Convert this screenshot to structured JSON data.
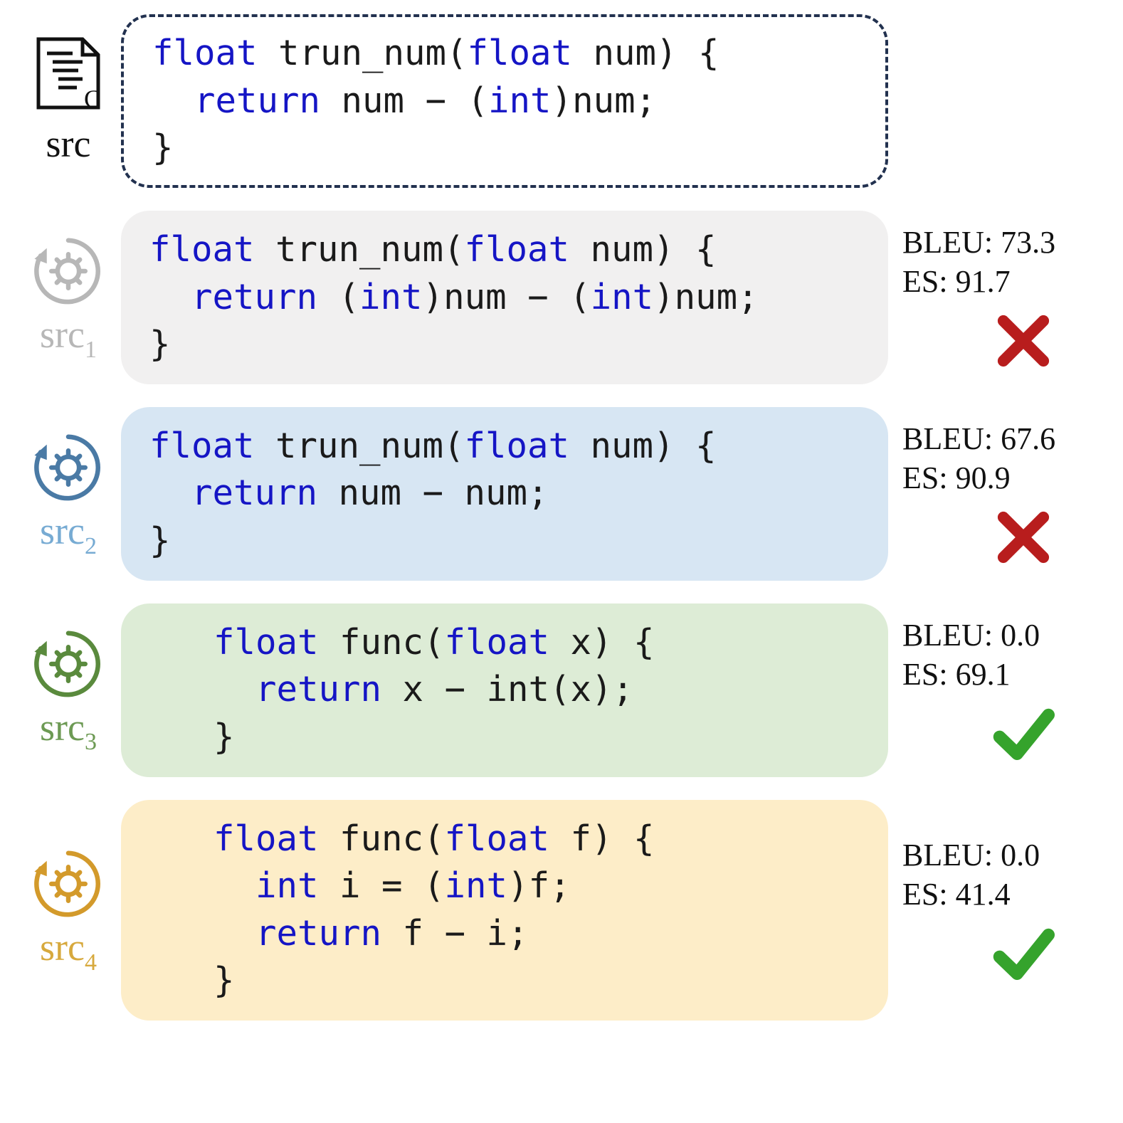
{
  "src": {
    "label": "src",
    "code": {
      "sig_prefix": "float",
      "sig_name": " trun_num(",
      "sig_arg_type": "float",
      "sig_arg_rest": " num) {",
      "body_indent": "  ",
      "ret_kw": "return",
      "ret_expr": " num − (",
      "cast_type": "int",
      "ret_tail": ")num;",
      "close": "}"
    }
  },
  "candidates": [
    {
      "id": "src1",
      "label_base": "src",
      "label_sub": "1",
      "color": "gray",
      "bleu": "BLEU: 73.3",
      "es": "ES: 91.7",
      "correct": false,
      "code": {
        "sig_prefix": "float",
        "sig_name": " trun_num(",
        "sig_arg_type": "float",
        "sig_arg_rest": " num) {",
        "body_indent": "  ",
        "ret_kw": "return",
        "ret_a": " (",
        "cast1": "int",
        "ret_mid": ")num − (",
        "cast2": "int",
        "ret_tail": ")num;",
        "close": "}"
      }
    },
    {
      "id": "src2",
      "label_base": "src",
      "label_sub": "2",
      "color": "blue",
      "bleu": "BLEU: 67.6",
      "es": "ES: 90.9",
      "correct": false,
      "code": {
        "sig_prefix": "float",
        "sig_name": " trun_num(",
        "sig_arg_type": "float",
        "sig_arg_rest": " num) {",
        "body_indent": "  ",
        "ret_kw": "return",
        "ret_expr": " num − num;",
        "close": "}"
      }
    },
    {
      "id": "src3",
      "label_base": "src",
      "label_sub": "3",
      "color": "green",
      "bleu": "BLEU: 0.0",
      "es": "ES: 69.1",
      "correct": true,
      "code": {
        "sig_prefix": "float",
        "sig_name": " func(",
        "sig_arg_type": "float",
        "sig_arg_rest": " x) {",
        "body_indent": "  ",
        "ret_kw": "return",
        "ret_expr": " x − int(x);",
        "close": "}"
      }
    },
    {
      "id": "src4",
      "label_base": "src",
      "label_sub": "4",
      "color": "yellow",
      "bleu": "BLEU: 0.0",
      "es": "ES: 41.4",
      "correct": true,
      "code": {
        "sig_prefix": "float",
        "sig_name": " func(",
        "sig_arg_type": "float",
        "sig_arg_rest": " f) {",
        "body_indent": "  ",
        "line2_type": "int",
        "line2_rest_a": " i = (",
        "line2_cast": "int",
        "line2_rest_b": ")f;",
        "ret_kw": "return",
        "ret_expr": " f − i;",
        "close": "}"
      }
    }
  ],
  "colors": {
    "gray": "#b7b7b7",
    "blue": "#4a7aa5",
    "green": "#5a8a3d",
    "yellow": "#d39a2b"
  }
}
